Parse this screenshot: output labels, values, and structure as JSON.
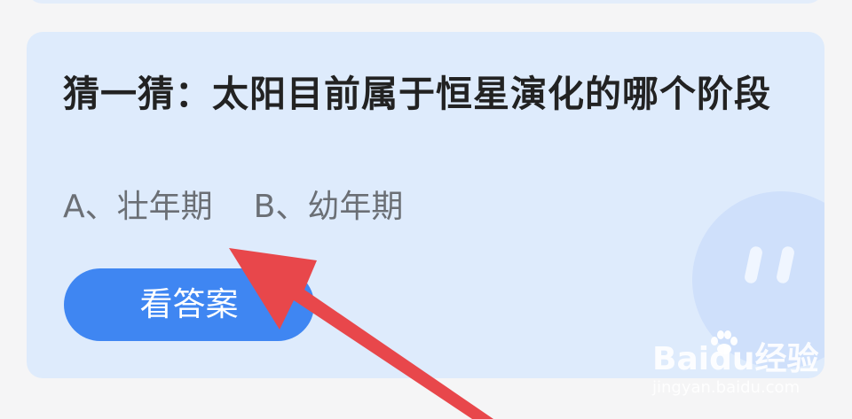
{
  "question": {
    "text": "猜一猜：太阳目前属于恒星演化的哪个阶段"
  },
  "options": [
    {
      "label": "A、壮年期"
    },
    {
      "label": "B、幼年期"
    }
  ],
  "answer_button": {
    "label": "看答案"
  },
  "watermark": {
    "logo": "Baidu经验",
    "url": "jingyan.baidu.com"
  },
  "colors": {
    "page_background": "#f5f5f6",
    "card_background": "#deebfc",
    "button": "#3f86f2",
    "arrow": "#e8474b"
  },
  "icons": {
    "arrow": "annotation-arrow-icon",
    "mascot": "mascot-icon",
    "watermark_paw": "paw-icon"
  }
}
